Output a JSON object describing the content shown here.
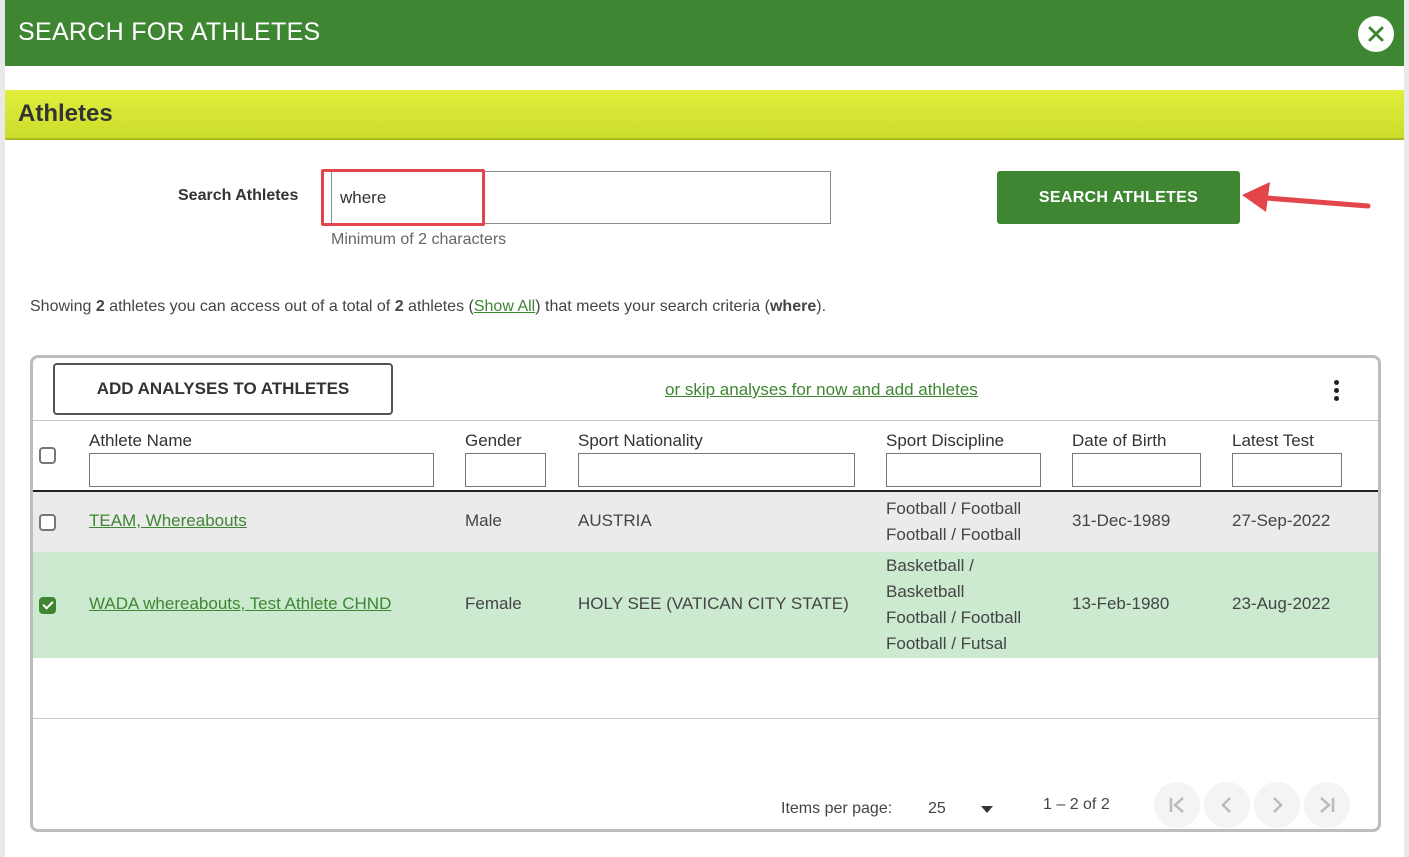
{
  "dialog": {
    "title": "SEARCH FOR ATHLETES"
  },
  "section": {
    "title": "Athletes"
  },
  "search": {
    "label": "Search Athletes",
    "value": "where",
    "hint": "Minimum of 2 characters",
    "button_label": "SEARCH ATHLETES"
  },
  "summary": {
    "prefix": "Showing ",
    "count_accessible": "2",
    "mid1": " athletes you can access out of a total of ",
    "count_total": "2",
    "mid2": " athletes (",
    "show_all": "Show All",
    "mid3": ") that meets your search criteria (",
    "criteria": "where",
    "suffix": ")."
  },
  "grid": {
    "add_button": "ADD ANALYSES TO ATHLETES",
    "skip_link": "or skip analyses for now and add athletes",
    "columns": [
      "Athlete Name",
      "Gender",
      "Sport Nationality",
      "Sport Discipline",
      "Date of Birth",
      "Latest Test"
    ],
    "rows": [
      {
        "checked": false,
        "name": "TEAM, Whereabouts",
        "gender": "Male",
        "nationality": "AUSTRIA",
        "disciplines": [
          "Football / Football",
          "Football / Football"
        ],
        "dob": "31-Dec-1989",
        "latest_test": "27-Sep-2022"
      },
      {
        "checked": true,
        "name": "WADA whereabouts, Test Athlete CHND",
        "gender": "Female",
        "nationality": "HOLY SEE (VATICAN CITY STATE)",
        "disciplines": [
          "Basketball /",
          "Basketball",
          "Football / Football",
          "Football / Futsal"
        ],
        "dob": "13-Feb-1980",
        "latest_test": "23-Aug-2022"
      }
    ]
  },
  "paginator": {
    "items_per_page_label": "Items per page:",
    "items_per_page_value": "25",
    "range": "1 – 2 of 2"
  },
  "colors": {
    "primary_green": "#3f8633",
    "section_lime": "#d4e433",
    "selected_row": "#ccead0",
    "annotation_red": "#e2464a"
  },
  "icons": [
    "close-icon",
    "kebab-menu-icon",
    "dropdown-caret-icon",
    "first-page-icon",
    "previous-page-icon",
    "next-page-icon",
    "last-page-icon",
    "annotation-arrow-icon"
  ]
}
